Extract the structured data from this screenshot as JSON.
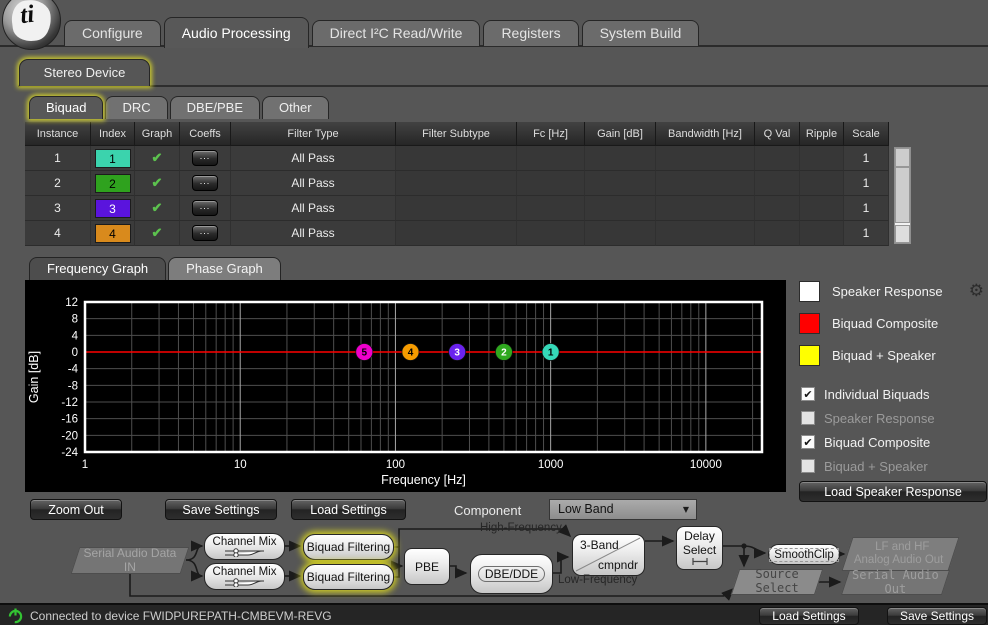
{
  "logo": {
    "text": "ti"
  },
  "main_tabs": [
    {
      "label": "Configure",
      "selected": false
    },
    {
      "label": "Audio Processing",
      "selected": true
    },
    {
      "label": "Direct I²C Read/Write",
      "selected": false
    },
    {
      "label": "Registers",
      "selected": false
    },
    {
      "label": "System Build",
      "selected": false
    }
  ],
  "device_tab": {
    "label": "Stereo Device"
  },
  "sub_tabs": [
    {
      "label": "Biquad",
      "selected": true
    },
    {
      "label": "DRC",
      "selected": false
    },
    {
      "label": "DBE/PBE",
      "selected": false
    },
    {
      "label": "Other",
      "selected": false
    }
  ],
  "biquad_table": {
    "columns": [
      "Instance",
      "Index",
      "Graph",
      "Coeffs",
      "Filter Type",
      "Filter Subtype",
      "Fc [Hz]",
      "Gain [dB]",
      "Bandwidth [Hz]",
      "Q Val",
      "Ripple",
      "Scale"
    ],
    "rows": [
      {
        "instance": "1",
        "index": "1",
        "index_color": "#3bd3ad",
        "index_text_color": "#000000",
        "graph_checked": true,
        "coeffs_label": "...",
        "filter_type": "All Pass",
        "filter_subtype": "",
        "fc": "",
        "gain": "",
        "bandwidth": "",
        "q_val": "",
        "ripple": "",
        "scale": "1"
      },
      {
        "instance": "2",
        "index": "2",
        "index_color": "#2fa21e",
        "index_text_color": "#000000",
        "graph_checked": true,
        "coeffs_label": "...",
        "filter_type": "All Pass",
        "filter_subtype": "",
        "fc": "",
        "gain": "",
        "bandwidth": "",
        "q_val": "",
        "ripple": "",
        "scale": "1"
      },
      {
        "instance": "3",
        "index": "3",
        "index_color": "#5a14dd",
        "index_text_color": "#ffffff",
        "graph_checked": true,
        "coeffs_label": "...",
        "filter_type": "All Pass",
        "filter_subtype": "",
        "fc": "",
        "gain": "",
        "bandwidth": "",
        "q_val": "",
        "ripple": "",
        "scale": "1"
      },
      {
        "instance": "4",
        "index": "4",
        "index_color": "#d98a1c",
        "index_text_color": "#000000",
        "graph_checked": true,
        "coeffs_label": "...",
        "filter_type": "All Pass",
        "filter_subtype": "",
        "fc": "",
        "gain": "",
        "bandwidth": "",
        "q_val": "",
        "ripple": "",
        "scale": "1"
      }
    ]
  },
  "graph_tabs": [
    {
      "label": "Frequency Graph",
      "selected": true
    },
    {
      "label": "Phase Graph",
      "selected": false
    }
  ],
  "chart_data": {
    "type": "line",
    "title": "",
    "xlabel": "Frequency [Hz]",
    "ylabel": "Gain [dB]",
    "xscale": "log",
    "xlim": [
      1,
      23000
    ],
    "ylim": [
      -24,
      12
    ],
    "yticks": [
      12,
      8,
      4,
      0,
      -4,
      -8,
      -12,
      -16,
      -20,
      -24
    ],
    "xticks": [
      1,
      10,
      100,
      1000,
      10000
    ],
    "grid": true,
    "plot_bg": "#000000",
    "series": [
      {
        "name": "Biquad Composite",
        "color": "#ff0000",
        "points": [
          [
            1,
            0
          ],
          [
            23000,
            0
          ]
        ]
      }
    ],
    "markers": [
      {
        "label": "5",
        "freq": 63,
        "gain": 0,
        "color": "#ee00cc",
        "text_color": "#000000"
      },
      {
        "label": "4",
        "freq": 125,
        "gain": 0,
        "color": "#f59b00",
        "text_color": "#000000"
      },
      {
        "label": "3",
        "freq": 250,
        "gain": 0,
        "color": "#6a22ee",
        "text_color": "#ffffff"
      },
      {
        "label": "2",
        "freq": 500,
        "gain": 0,
        "color": "#2fa81f",
        "text_color": "#ffffff"
      },
      {
        "label": "1",
        "freq": 1000,
        "gain": 0,
        "color": "#35d8b8",
        "text_color": "#000000"
      }
    ]
  },
  "legend": [
    {
      "label": "Speaker Response",
      "color": "#ffffff",
      "gear": true
    },
    {
      "label": "Biquad Composite",
      "color": "#ff0000",
      "gear": false
    },
    {
      "label": "Biquad + Speaker",
      "color": "#ffff00",
      "gear": false
    }
  ],
  "display_checkboxes": [
    {
      "label": "Individual Biquads",
      "checked": true
    },
    {
      "label": "Speaker Response",
      "checked": false
    },
    {
      "label": "Biquad Composite",
      "checked": true
    },
    {
      "label": "Biquad + Speaker",
      "checked": false
    }
  ],
  "buttons": {
    "load_speaker_response": "Load Speaker Response",
    "zoom_out": "Zoom Out",
    "save_settings": "Save Settings",
    "load_settings": "Load Settings"
  },
  "component": {
    "label": "Component",
    "value": "Low Band"
  },
  "flow": {
    "nodes": {
      "serial_in": "Serial Audio Data IN",
      "channel_mix_1": "Channel Mix",
      "channel_mix_2": "Channel Mix",
      "biquad_1": "Biquad Filtering",
      "biquad_2": "Biquad Filtering",
      "pbe": "PBE",
      "dbe": "DBE/DDE",
      "compander_line1": "3-Band",
      "compander_line2": "cmpndr",
      "delay_line1": "Delay",
      "delay_line2": "Select",
      "smoothclip": "SmoothClip",
      "analog_out_line1": "LF and HF",
      "analog_out_line2": "Analog Audio Out",
      "source_select": "Source Select",
      "serial_out": "Serial Audio Out"
    },
    "path_labels": {
      "high": "High-Frequency",
      "low": "Low-Frequency"
    }
  },
  "status_bar": {
    "text": "Connected to device FWIDPUREPATH-CMBEVM-REVG",
    "load_settings": "Load Settings",
    "save_settings": "Save Settings"
  },
  "icons": {
    "check": "✔",
    "gear": "⚙",
    "dropdown_arrow": "▼"
  }
}
